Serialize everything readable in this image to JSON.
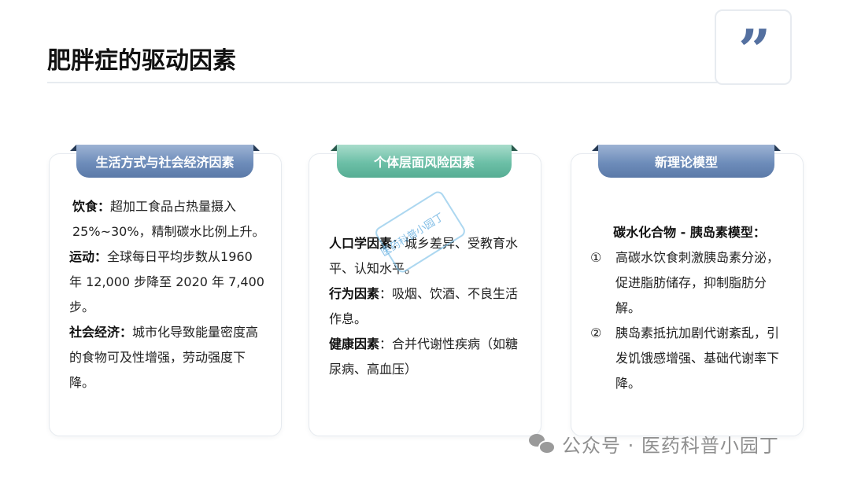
{
  "header": {
    "title": "肥胖症的驱动因素",
    "quote_icon": "quote-icon"
  },
  "cards": [
    {
      "tab": "生活方式与社会经济因素",
      "items": [
        {
          "key": "饮食",
          "sep": "：",
          "text": "超加工食品占热量摄入25%~30%，精制碳水比例上升。"
        },
        {
          "key": "运动",
          "sep": "：",
          "text": "全球每日平均步数从1960 年 12,000 步降至 2020 年 7,400 步。"
        },
        {
          "key": "社会经济：",
          "sep": "",
          "text": "城市化导致能量密度高的食物可及性增强，劳动强度下降。"
        }
      ]
    },
    {
      "tab": "个体层面风险因素",
      "items": [
        {
          "key": "人口学因素",
          "sep": "：",
          "text": "城乡差异、受教育水平、认知水平。"
        },
        {
          "key": "行为因素",
          "sep": "：",
          "text": "吸烟、饮酒、不良生活作息。"
        },
        {
          "key": "健康因素",
          "sep": "：",
          "text": "合并代谢性疾病（如糖尿病、高血压）"
        }
      ]
    },
    {
      "tab": "新理论模型",
      "heading": "碳水化合物 - 胰岛素模型：",
      "points": [
        {
          "num": "①",
          "text": "高碳水饮食刺激胰岛素分泌，促进脂肪储存，抑制脂肪分解。"
        },
        {
          "num": "②",
          "text": "胰岛素抵抗加剧代谢紊乱，引发饥饿感增强、基础代谢率下降。"
        }
      ]
    }
  ],
  "stamp": {
    "text": "医药科普小园丁"
  },
  "watermark": {
    "icon": "wechat-icon",
    "text": "公众号 · 医药科普小园丁"
  }
}
